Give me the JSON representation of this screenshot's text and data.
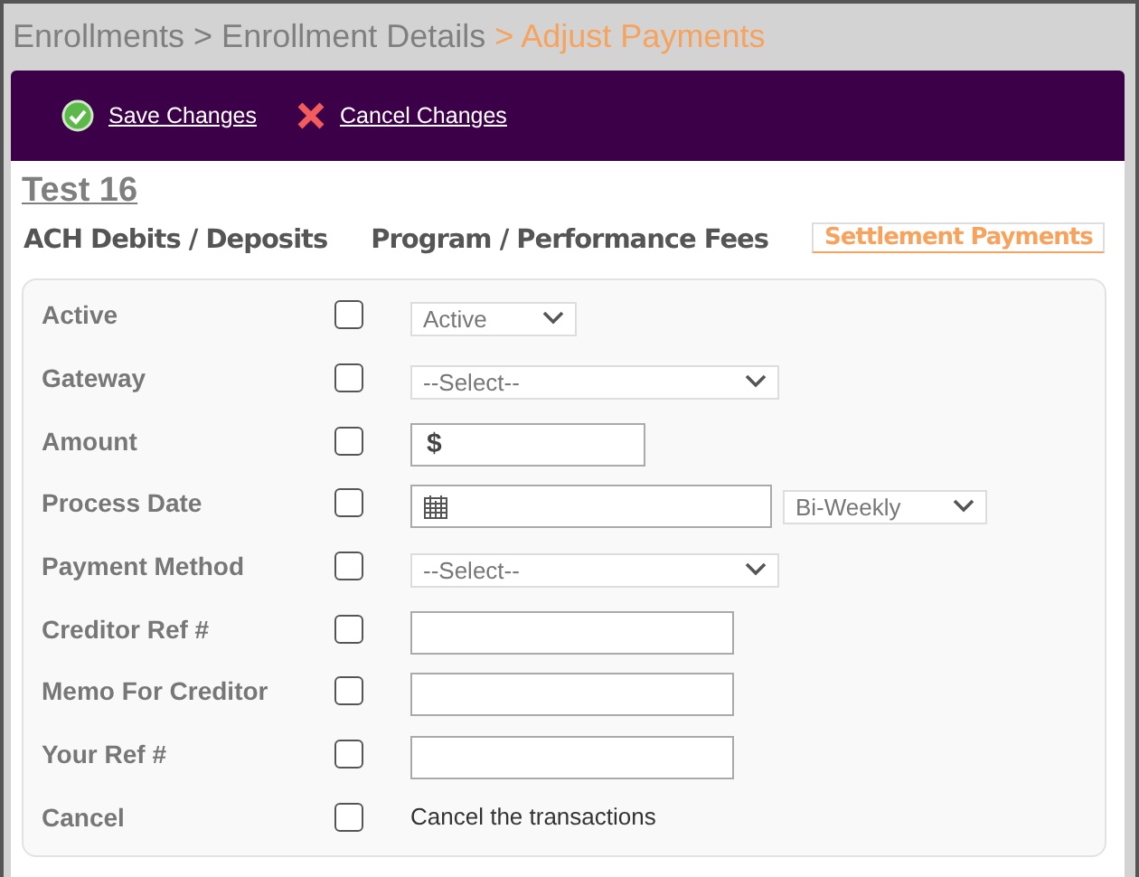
{
  "breadcrumb": [
    {
      "label": "Enrollments",
      "current": false
    },
    {
      "label": "> Enrollment Details",
      "current": false
    },
    {
      "label": "> Adjust Payments",
      "current": true
    }
  ],
  "toolbar": [
    {
      "label": "Save Changes",
      "kind": "save"
    },
    {
      "label": "Cancel Changes",
      "kind": "cancel"
    }
  ],
  "title": "Test 16",
  "tabs": [
    {
      "label": "ACH Debits / Deposits",
      "selected": false
    },
    {
      "label": "Program / Performance Fees",
      "selected": false
    },
    {
      "label": "Settlement Payments",
      "selected": true
    }
  ],
  "rows": [
    {
      "label": "Active",
      "checked": false,
      "kind": "short-select",
      "value": "Active"
    },
    {
      "label": "Gateway",
      "checked": false,
      "kind": "select",
      "value": "--Select--"
    },
    {
      "label": "Amount",
      "checked": false,
      "kind": "dollar",
      "prefix": "$"
    },
    {
      "label": "Process Date",
      "checked": false,
      "kind": "date",
      "extra": "Bi-Weekly"
    },
    {
      "label": "Payment Method",
      "checked": false,
      "kind": "select",
      "value": "--Select--"
    },
    {
      "label": "Creditor Ref #",
      "checked": false,
      "kind": "text"
    },
    {
      "label": "Memo For Creditor",
      "checked": false,
      "kind": "text"
    },
    {
      "label": "Your Ref #",
      "checked": false,
      "kind": "text"
    },
    {
      "label": "Cancel",
      "checked": false,
      "kind": "note",
      "note": "Cancel the transactions"
    }
  ]
}
